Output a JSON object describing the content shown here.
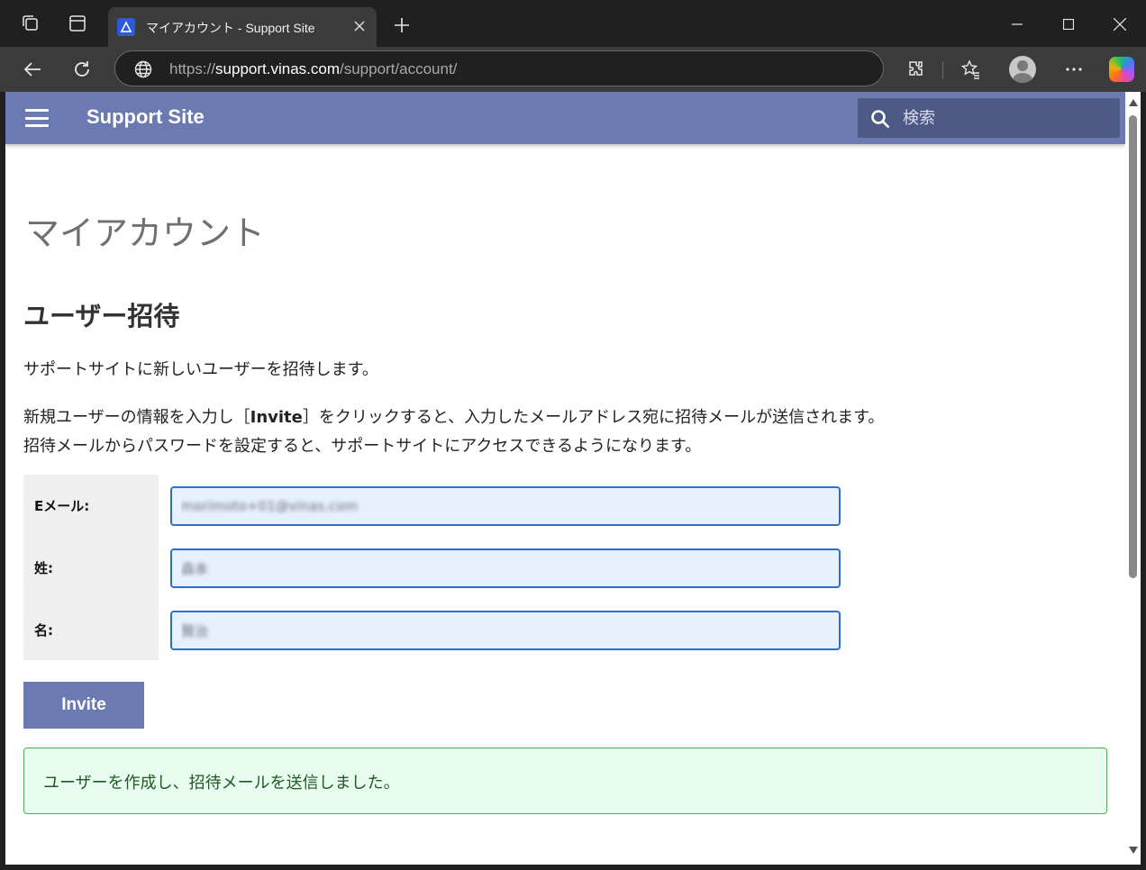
{
  "browser": {
    "tab_title": "マイアカウント - Support Site",
    "url_scheme": "https://",
    "url_host": "support.vinas.com",
    "url_path": "/support/account/",
    "tab_actions_icon": "tab-actions-icon",
    "vertical_tabs_icon": "vertical-tabs-icon"
  },
  "site": {
    "brand": "Support Site",
    "search_placeholder": "検索",
    "accent_color": "#6b7ab0"
  },
  "page": {
    "title": "マイアカウント",
    "section_title": "ユーザー招待",
    "intro": "サポートサイトに新しいユーザーを招待します。",
    "instructions_pre": "新規ユーザーの情報を入力し［",
    "instructions_bold": "Invite",
    "instructions_post": "］をクリックすると、入力したメールアドレス宛に招待メールが送信されます。",
    "instructions_line2": "招待メールからパスワードを設定すると、サポートサイトにアクセスできるようになります。"
  },
  "form": {
    "email_label": "Eメール:",
    "email_value": "morimoto+01@vinas.com",
    "last_name_label": "姓:",
    "last_name_value": "森本",
    "first_name_label": "名:",
    "first_name_value": "賢治",
    "submit_label": "Invite"
  },
  "alert": {
    "message": "ユーザーを作成し、招待メールを送信しました。",
    "color": "#4caf50"
  }
}
